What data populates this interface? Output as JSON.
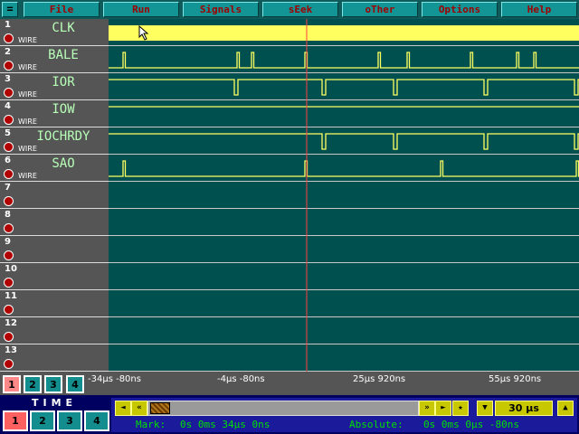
{
  "menu": {
    "system_label": "=",
    "items": [
      {
        "label": "File",
        "name": "menu-file"
      },
      {
        "label": "Run",
        "name": "menu-run"
      },
      {
        "label": "Signals",
        "name": "menu-signals"
      },
      {
        "label": "sEek",
        "name": "menu-seek"
      },
      {
        "label": "oTher",
        "name": "menu-other"
      },
      {
        "label": "Options",
        "name": "menu-options"
      },
      {
        "label": "Help",
        "name": "menu-help"
      }
    ]
  },
  "rows": [
    {
      "num": "1",
      "name": "CLK",
      "type": "WIRE"
    },
    {
      "num": "2",
      "name": "BALE",
      "type": "WIRE"
    },
    {
      "num": "3",
      "name": "IOR",
      "type": "WIRE"
    },
    {
      "num": "4",
      "name": "IOW",
      "type": "WIRE"
    },
    {
      "num": "5",
      "name": "IOCHRDY",
      "type": "WIRE"
    },
    {
      "num": "6",
      "name": "SAO",
      "type": "WIRE"
    },
    {
      "num": "7",
      "name": "",
      "type": ""
    },
    {
      "num": "8",
      "name": "",
      "type": ""
    },
    {
      "num": "9",
      "name": "",
      "type": ""
    },
    {
      "num": "10",
      "name": "",
      "type": ""
    },
    {
      "num": "11",
      "name": "",
      "type": ""
    },
    {
      "num": "12",
      "name": "",
      "type": ""
    },
    {
      "num": "13",
      "name": "",
      "type": ""
    }
  ],
  "waveforms": {
    "BALE": {
      "kind": "pulse-high",
      "positions_us": [
        -43.8,
        -18.6,
        -15.4,
        -3.6,
        12.6,
        19.0,
        33.0,
        43.2,
        47.0,
        72.4,
        73.6
      ]
    },
    "IOR": {
      "kind": "pulse-low",
      "positions_us": [
        -19.2,
        0.2,
        16.0,
        36.0,
        56.0
      ]
    },
    "IOCHRDY": {
      "kind": "pulse-low",
      "positions_us": [
        0.2,
        16.0,
        36.0,
        56.0
      ]
    },
    "SAO": {
      "kind": "pulse-high",
      "positions_us": [
        -43.8,
        -3.6,
        26.4,
        56.4
      ]
    },
    "cursor_us": -3.2
  },
  "scale": {
    "page_buttons": [
      "1",
      "2",
      "3",
      "4"
    ],
    "active_page": "1",
    "ticks": [
      "-34µs -80ns",
      "-4µs -80ns",
      "25µs 920ns",
      "55µs 920ns"
    ]
  },
  "time_panel": {
    "title": "TIME",
    "buttons": [
      "1",
      "2",
      "3",
      "4"
    ],
    "active": "1",
    "nav_left": [
      "◄",
      "«"
    ],
    "nav_right": [
      "»",
      "►",
      "★"
    ],
    "zoom_down": "▼",
    "zoom_up": "▲",
    "zoom_value": "30 µs",
    "mark_label": "Mark:",
    "mark_value": "0s    0ms  34µs   0ns",
    "absolute_label": "Absolute:",
    "absolute_value": "0s    0ms   0µs -80ns"
  },
  "colors": {
    "menu_bg": "#139595",
    "menu_text": "#a00000",
    "wave_bg": "#005050",
    "wave_line": "#ffff60",
    "clk_fill": "#ffff60",
    "cursor": "#ff4040",
    "label_text": "#b8ffb8"
  }
}
